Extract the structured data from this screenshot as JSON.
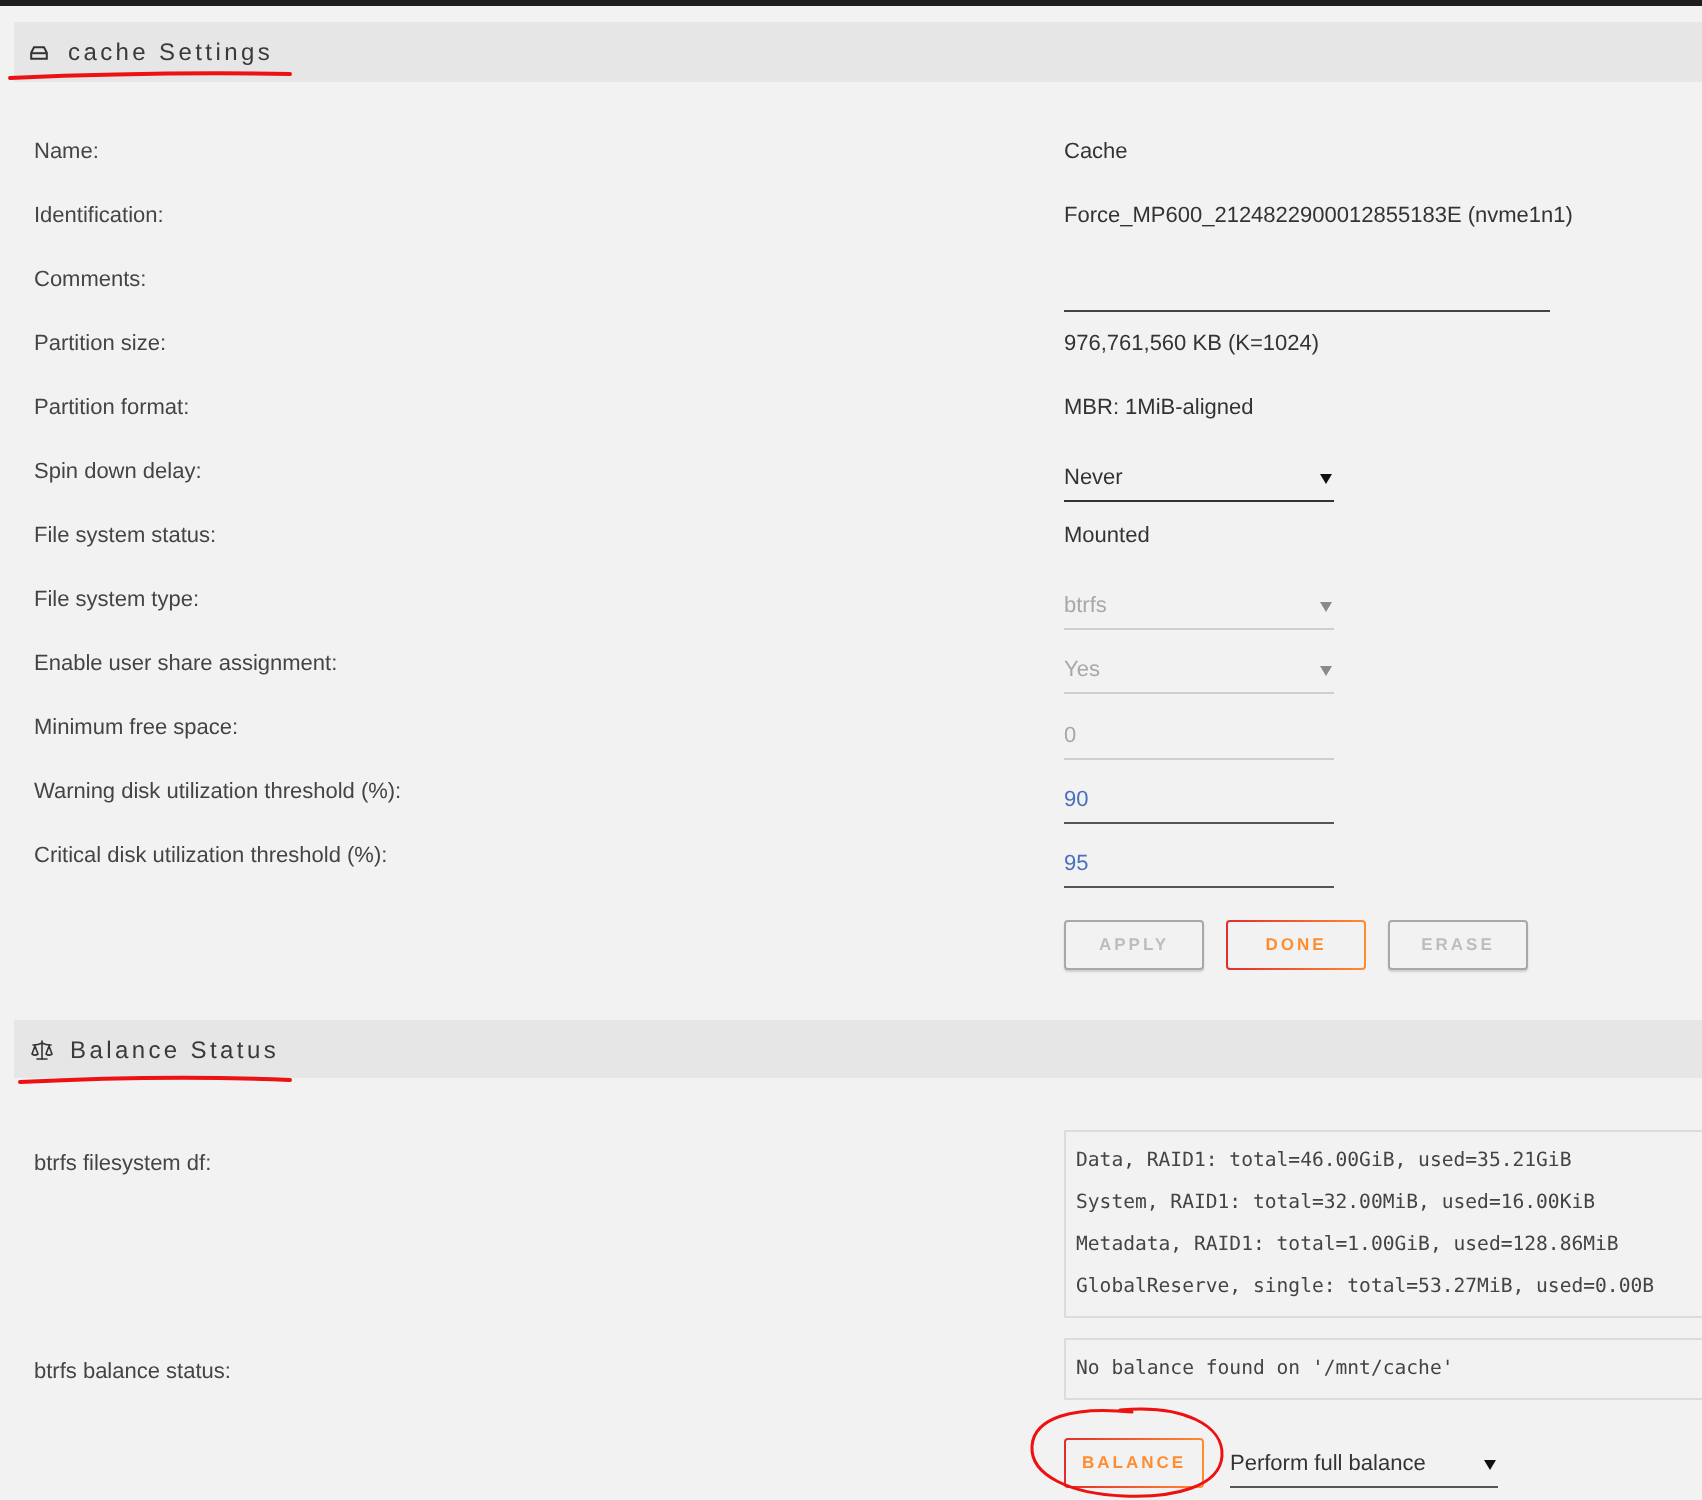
{
  "cache_settings": {
    "title": "cache Settings",
    "fields": [
      {
        "kind": "text",
        "label": "Name:",
        "value": "Cache"
      },
      {
        "kind": "text",
        "label": "Identification:",
        "value": "Force_MP600_2124822900012855183E (nvme1n1)"
      },
      {
        "kind": "text_input",
        "label": "Comments:",
        "disabled": false
      },
      {
        "kind": "text",
        "label": "Partition size:",
        "value": "976,761,560 KB (K=1024)"
      },
      {
        "kind": "text",
        "label": "Partition format:",
        "value": "MBR: 1MiB-aligned"
      },
      {
        "kind": "select",
        "label": "Spin down delay:",
        "value": "Never",
        "disabled": false
      },
      {
        "kind": "text",
        "label": "File system status:",
        "value": "Mounted"
      },
      {
        "kind": "select",
        "label": "File system type:",
        "value": "btrfs",
        "disabled": true
      },
      {
        "kind": "select",
        "label": "Enable user share assignment:",
        "value": "Yes",
        "disabled": true
      },
      {
        "kind": "number_input",
        "label": "Minimum free space:",
        "value": "0",
        "disabled": true
      },
      {
        "kind": "number_input",
        "label": "Warning disk utilization threshold (%):",
        "value": "90",
        "disabled": false
      },
      {
        "kind": "number_input",
        "label": "Critical disk utilization threshold (%):",
        "value": "95",
        "disabled": false
      }
    ],
    "buttons": [
      {
        "label": "APPLY",
        "disabled": true
      },
      {
        "label": "DONE",
        "disabled": false
      },
      {
        "label": "ERASE",
        "disabled": true
      }
    ]
  },
  "balance_status": {
    "title": "Balance Status",
    "fields": [
      {
        "label": "btrfs filesystem df:",
        "lines": [
          "Data, RAID1: total=46.00GiB, used=35.21GiB",
          "System, RAID1: total=32.00MiB, used=16.00KiB",
          "Metadata, RAID1: total=1.00GiB, used=128.86MiB",
          "GlobalReserve, single: total=53.27MiB, used=0.00B"
        ]
      },
      {
        "label": "btrfs balance status:",
        "lines": [
          "No balance found on '/mnt/cache'"
        ]
      }
    ],
    "balance_button": {
      "label": "BALANCE",
      "disabled": false
    },
    "mode_select": {
      "value": "Perform full balance"
    }
  }
}
